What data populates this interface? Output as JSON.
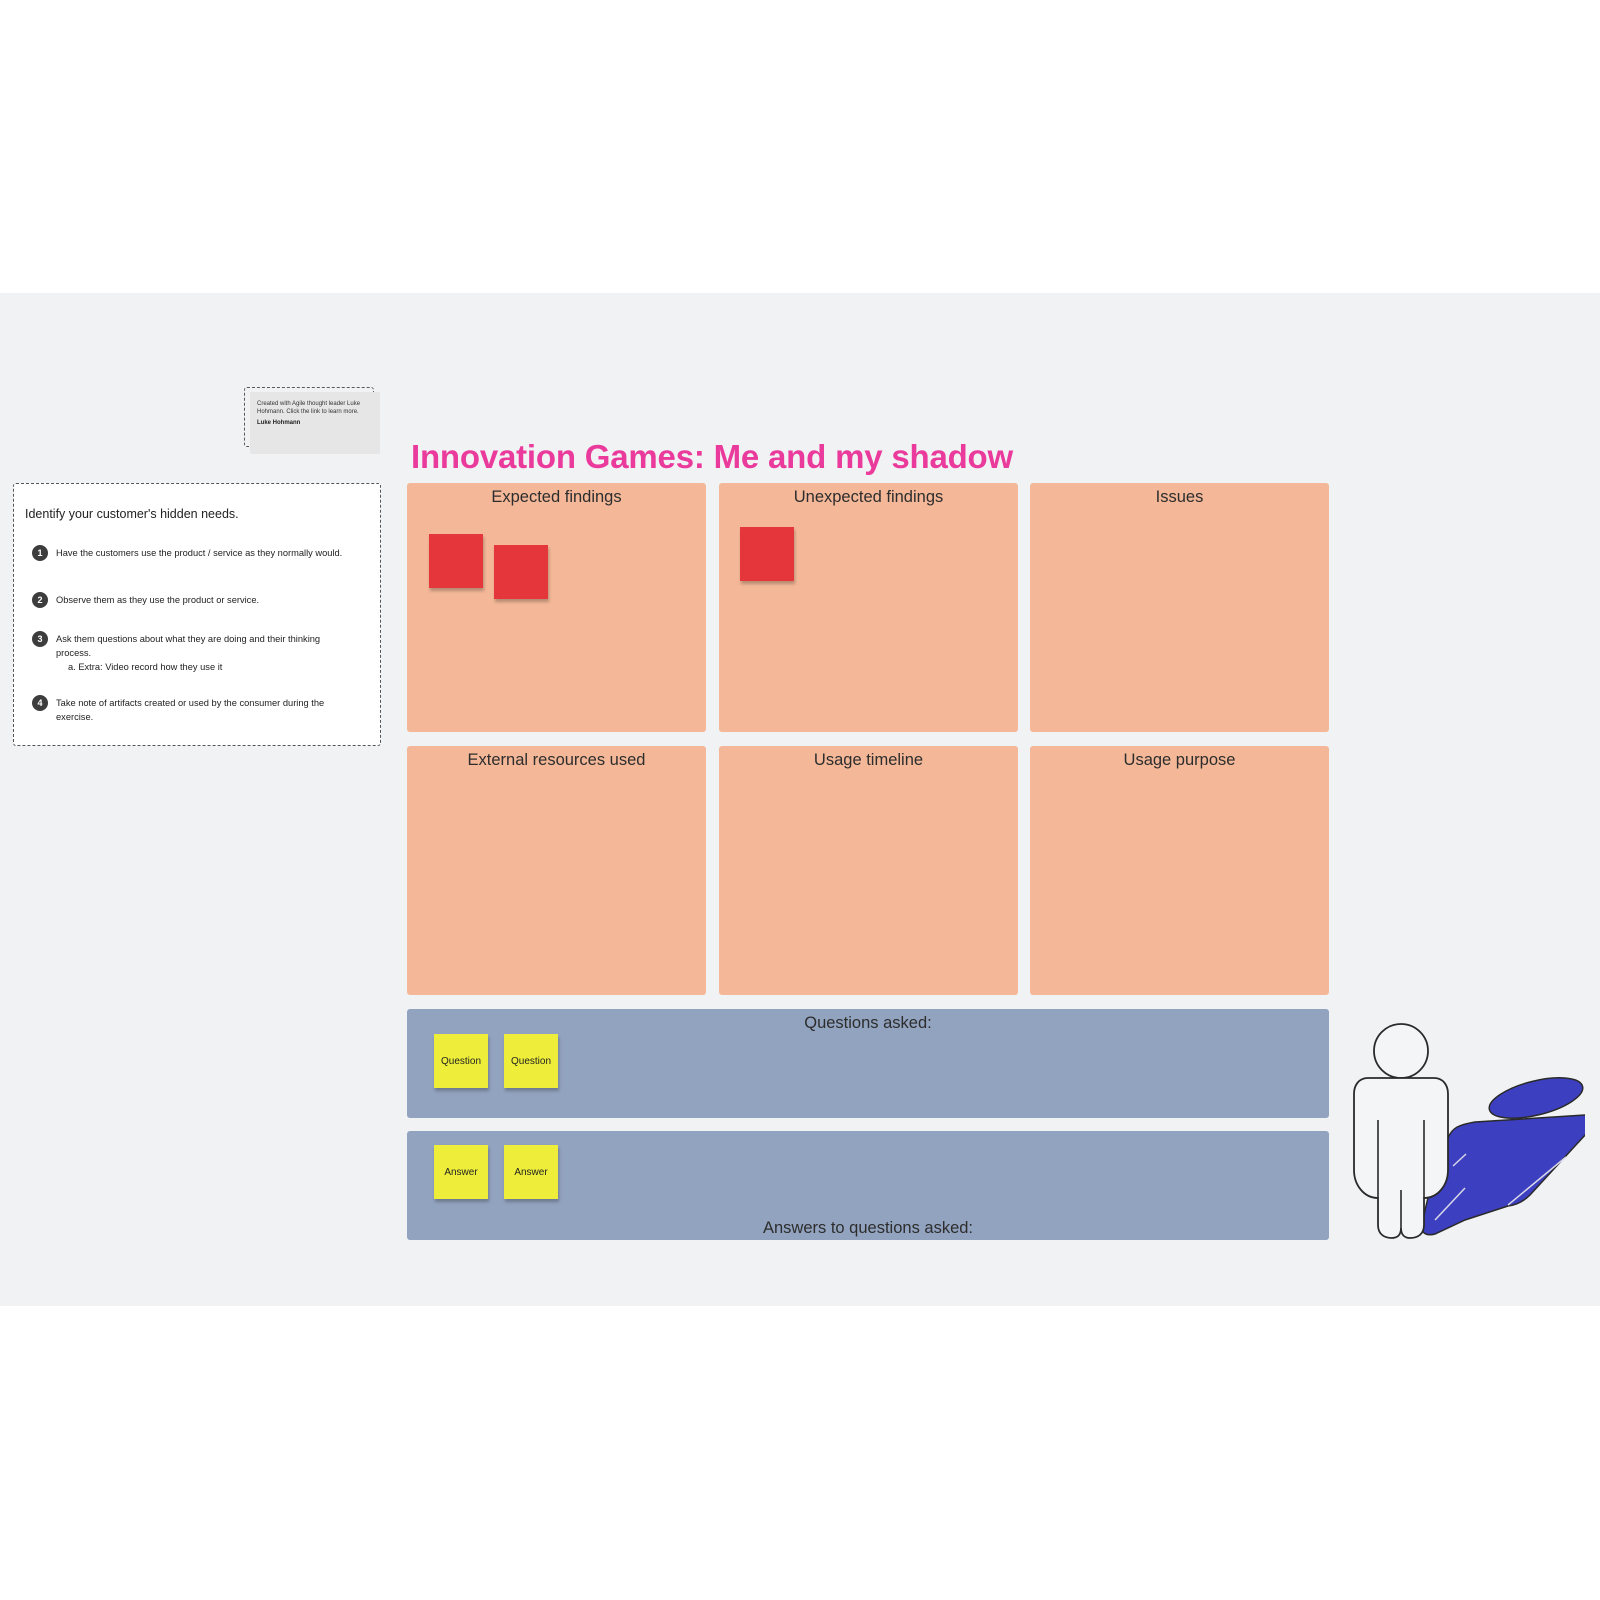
{
  "board": {
    "title": "Innovation Games: Me and my shadow"
  },
  "attribution": {
    "text": "Created with Agile thought leader Luke Hohmann. Click the link to learn more.",
    "author": "Luke Hohmann"
  },
  "instructions": {
    "heading": "Identify your customer's hidden needs.",
    "steps": [
      {
        "num": "1",
        "text": "Have the customers use the product / service as they normally would."
      },
      {
        "num": "2",
        "text": "Observe them as they use the product or service."
      },
      {
        "num": "3",
        "text": "Ask them questions about what they are doing and their thinking process.",
        "sub": "a. Extra: Video record how they use it"
      },
      {
        "num": "4",
        "text": "Take note of artifacts created or used by the consumer during the exercise."
      }
    ]
  },
  "panels": [
    {
      "label": "Expected findings",
      "sticky_count": 2
    },
    {
      "label": "Unexpected findings",
      "sticky_count": 1
    },
    {
      "label": "Issues",
      "sticky_count": 0
    },
    {
      "label": "External resources used",
      "sticky_count": 0
    },
    {
      "label": "Usage timeline",
      "sticky_count": 0
    },
    {
      "label": "Usage purpose",
      "sticky_count": 0
    }
  ],
  "questions": {
    "label": "Questions asked:",
    "stickies": [
      "Question",
      "Question"
    ]
  },
  "answers": {
    "label": "Answers to questions asked:",
    "stickies": [
      "Answer",
      "Answer"
    ]
  },
  "colors": {
    "title": "#ea3b9c",
    "panel": "#f4b898",
    "band": "#92a3bf",
    "sticky_red": "#e5363c",
    "sticky_yellow": "#eeee3a",
    "shadow": "#3c3fbf",
    "canvas": "#f1f2f4"
  },
  "illustration": {
    "icon": "person-with-shadow-icon"
  }
}
